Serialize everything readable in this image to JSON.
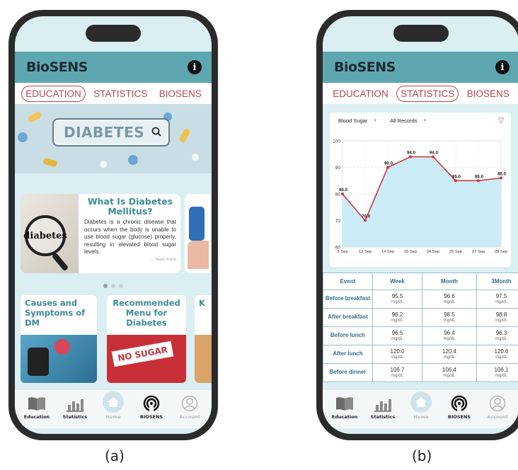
{
  "app": {
    "logo": "BioSENS"
  },
  "tabs": [
    "EDUCATION",
    "STATISTICS",
    "BIOSENS"
  ],
  "screen_a": {
    "search_text": "DIABETES",
    "article": {
      "image_word": "diabetes",
      "title": "What Is Diabetes Mellitus?",
      "text": "Diabetes is a chronic disease that occurs when the body is unable to use blood sugar (glucose) properly, resulting in elevated blood sugar levels.",
      "read_more": "... read more"
    },
    "categories": [
      {
        "title": "Causes and Symptoms of DM"
      },
      {
        "title": "Recommended Menu for Diabetes",
        "badge": "NO SUGAR"
      },
      {
        "title": "K"
      }
    ]
  },
  "screen_b": {
    "filter_1": "Blood Sugar",
    "filter_2": "All Records",
    "table": {
      "headers": [
        "Event",
        "Week",
        "Month",
        "3Month"
      ],
      "unit": "mg/dL",
      "rows": [
        {
          "event": "Before breakfast",
          "values": [
            "95.5",
            "96.6",
            "97.5"
          ]
        },
        {
          "event": "After breakfast",
          "values": [
            "98.2",
            "98.5",
            "98.8"
          ]
        },
        {
          "event": "Before lunch",
          "values": [
            "96.5",
            "96.4",
            "96.3"
          ]
        },
        {
          "event": "After lunch",
          "values": [
            "120.0",
            "120.4",
            "120.6"
          ]
        },
        {
          "event": "Before dinner",
          "values": [
            "106.7",
            "106.4",
            "106.1"
          ]
        }
      ]
    }
  },
  "nav": [
    {
      "label": "Education",
      "icon": "book-icon"
    },
    {
      "label": "Statistics",
      "icon": "bar-chart-icon"
    },
    {
      "label": "Home",
      "icon": "home-icon"
    },
    {
      "label": "BIOSENS",
      "icon": "sensor-icon"
    },
    {
      "label": "Account",
      "icon": "user-icon"
    }
  ],
  "captions": [
    "(a)",
    "(b)"
  ],
  "chart_data": {
    "type": "area",
    "categories": [
      "5 Sep",
      "12 Sep",
      "14 Sep",
      "23 Sep",
      "24 Sep",
      "25 Sep",
      "27 Sep",
      "28 Sep"
    ],
    "values": [
      80.0,
      70.0,
      90.0,
      94.0,
      94.0,
      85.0,
      85.0,
      86.0
    ],
    "data_labels": [
      "80.0",
      "70.0",
      "90.0",
      "94.0",
      "94.0",
      "85.0",
      "85.0",
      "86.0"
    ],
    "ylim": [
      60,
      100
    ],
    "yticks": [
      60,
      70,
      80,
      90,
      100
    ],
    "grid": true,
    "colors": {
      "line": "#d1343a",
      "fill": "#c5e9f6"
    }
  }
}
